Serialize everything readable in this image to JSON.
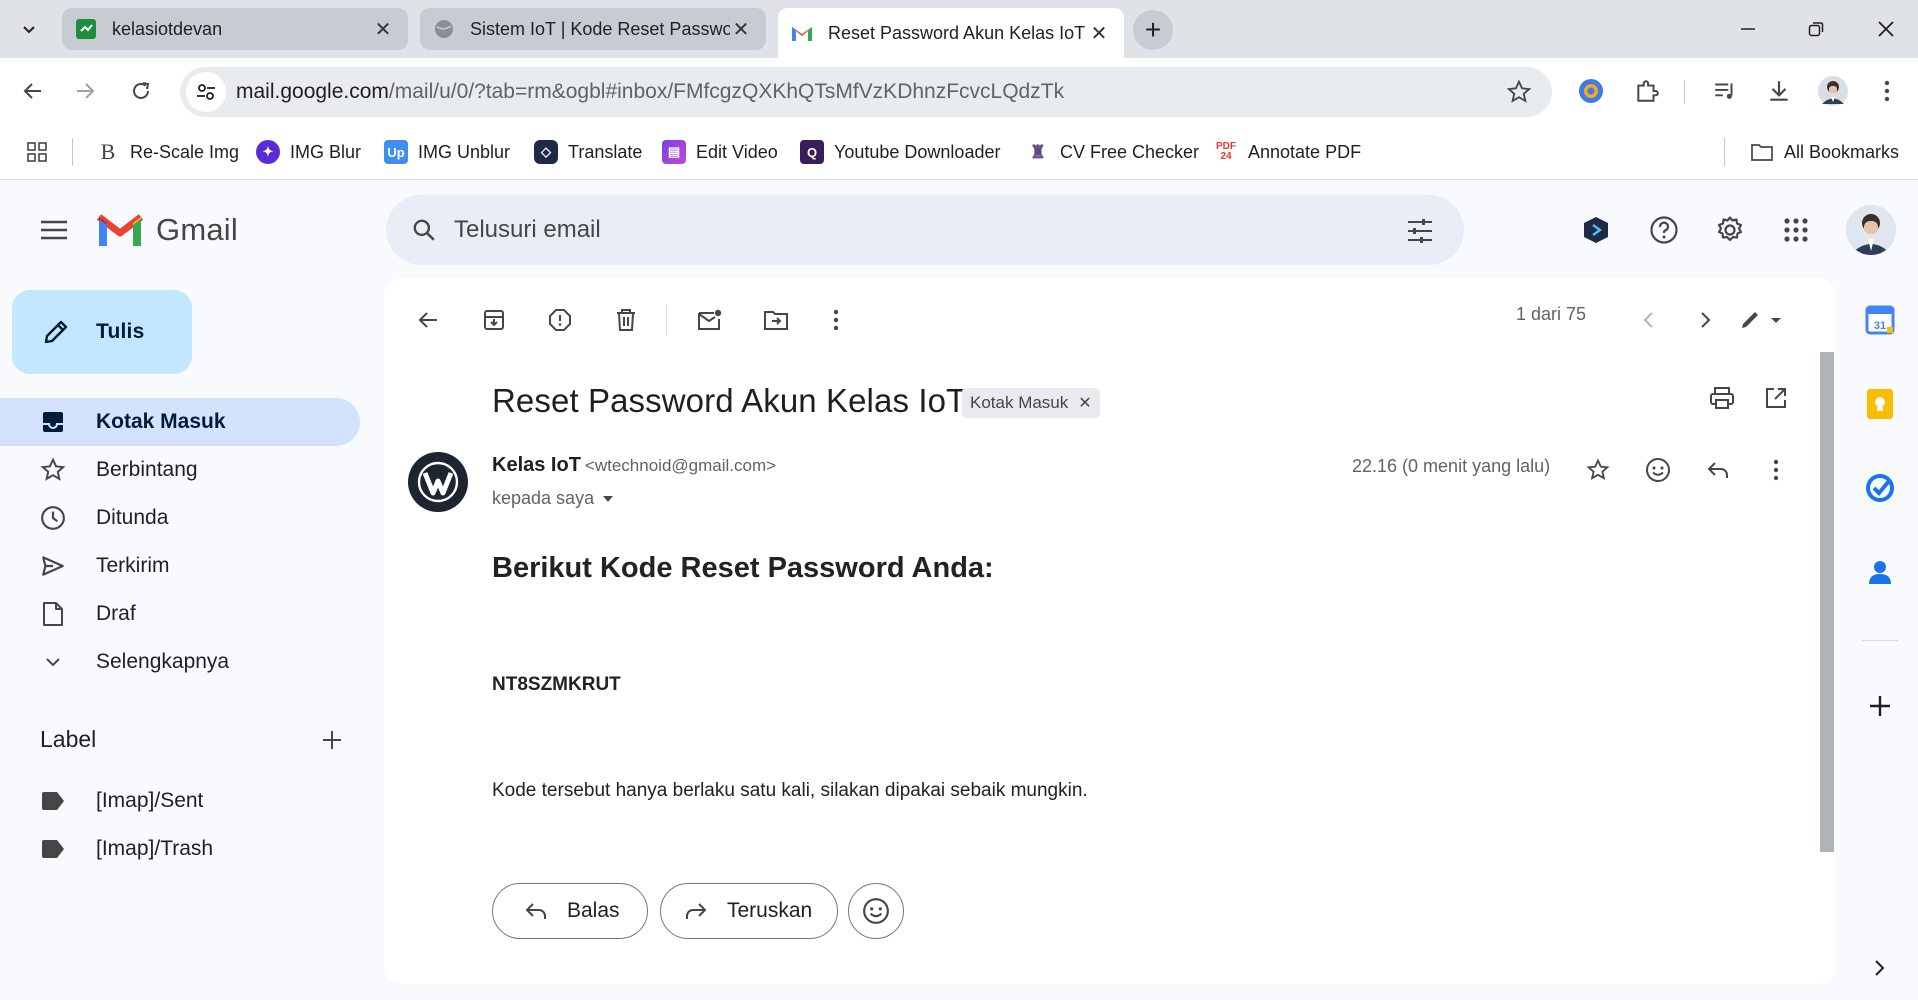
{
  "browser": {
    "tabs": [
      {
        "title": "kelasiotdevan",
        "active": false
      },
      {
        "title": "Sistem IoT | Kode Reset Passwor",
        "active": false
      },
      {
        "title": "Reset Password Akun Kelas IoT",
        "active": true
      }
    ],
    "url_host": "mail.google.com",
    "url_path": "/mail/u/0/?tab=rm&ogbl#inbox/FMfcgzQXKhQTsMfVzKDhnzFcvcLQdzTk",
    "bookmarks": [
      {
        "label": "Re-Scale Img",
        "icon": "rescale-icon"
      },
      {
        "label": "IMG Blur",
        "icon": "img-blur-icon"
      },
      {
        "label": "IMG Unblur",
        "icon": "img-unblur-icon"
      },
      {
        "label": "Translate",
        "icon": "translate-icon"
      },
      {
        "label": "Edit Video",
        "icon": "edit-video-icon"
      },
      {
        "label": "Youtube Downloader",
        "icon": "youtube-downloader-icon"
      },
      {
        "label": "CV Free Checker",
        "icon": "cv-checker-icon"
      },
      {
        "label": "Annotate PDF",
        "icon": "annotate-pdf-icon"
      }
    ],
    "all_bookmarks": "All Bookmarks"
  },
  "gmail": {
    "logo_text": "Gmail",
    "search_placeholder": "Telusuri email",
    "compose_label": "Tulis",
    "nav": [
      {
        "label": "Kotak Masuk",
        "icon": "inbox-icon",
        "active": true
      },
      {
        "label": "Berbintang",
        "icon": "star-icon",
        "active": false
      },
      {
        "label": "Ditunda",
        "icon": "clock-icon",
        "active": false
      },
      {
        "label": "Terkirim",
        "icon": "send-icon",
        "active": false
      },
      {
        "label": "Draf",
        "icon": "draft-icon",
        "active": false
      },
      {
        "label": "Selengkapnya",
        "icon": "chevron-down-icon",
        "active": false
      }
    ],
    "labels_heading": "Label",
    "labels": [
      {
        "label": "[Imap]/Sent"
      },
      {
        "label": "[Imap]/Trash"
      }
    ]
  },
  "email": {
    "pager": "1 dari 75",
    "subject": "Reset Password Akun Kelas IoT",
    "label_chip": "Kotak Masuk",
    "sender_name": "Kelas IoT",
    "sender_email": "<wtechnoid@gmail.com>",
    "to": "kepada saya",
    "time": "22.16 (0 menit yang lalu)",
    "heading": "Berikut Kode Reset Password Anda:",
    "code": "NT8SZMKRUT",
    "note": "Kode tersebut hanya berlaku satu kali, silakan dipakai sebaik mungkin.",
    "reply_label": "Balas",
    "forward_label": "Teruskan"
  },
  "colors": {
    "accent": "#0b57d0",
    "compose_bg": "#c2e7ff",
    "nav_active_bg": "#d3e3fd",
    "gmail_red": "#ea4335"
  }
}
